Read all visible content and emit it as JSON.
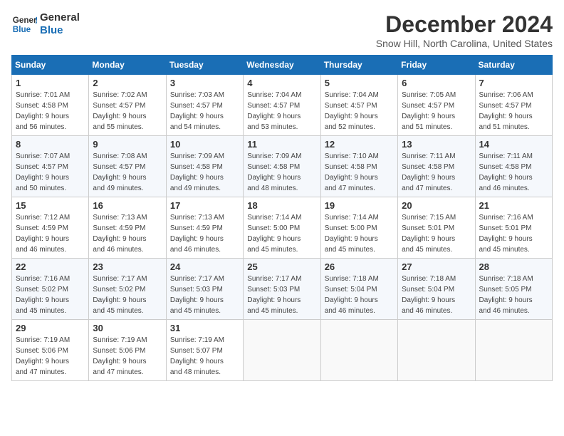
{
  "header": {
    "logo_line1": "General",
    "logo_line2": "Blue",
    "month_title": "December 2024",
    "location": "Snow Hill, North Carolina, United States"
  },
  "days_of_week": [
    "Sunday",
    "Monday",
    "Tuesday",
    "Wednesday",
    "Thursday",
    "Friday",
    "Saturday"
  ],
  "weeks": [
    [
      {
        "day": "1",
        "info": "Sunrise: 7:01 AM\nSunset: 4:58 PM\nDaylight: 9 hours\nand 56 minutes."
      },
      {
        "day": "2",
        "info": "Sunrise: 7:02 AM\nSunset: 4:57 PM\nDaylight: 9 hours\nand 55 minutes."
      },
      {
        "day": "3",
        "info": "Sunrise: 7:03 AM\nSunset: 4:57 PM\nDaylight: 9 hours\nand 54 minutes."
      },
      {
        "day": "4",
        "info": "Sunrise: 7:04 AM\nSunset: 4:57 PM\nDaylight: 9 hours\nand 53 minutes."
      },
      {
        "day": "5",
        "info": "Sunrise: 7:04 AM\nSunset: 4:57 PM\nDaylight: 9 hours\nand 52 minutes."
      },
      {
        "day": "6",
        "info": "Sunrise: 7:05 AM\nSunset: 4:57 PM\nDaylight: 9 hours\nand 51 minutes."
      },
      {
        "day": "7",
        "info": "Sunrise: 7:06 AM\nSunset: 4:57 PM\nDaylight: 9 hours\nand 51 minutes."
      }
    ],
    [
      {
        "day": "8",
        "info": "Sunrise: 7:07 AM\nSunset: 4:57 PM\nDaylight: 9 hours\nand 50 minutes."
      },
      {
        "day": "9",
        "info": "Sunrise: 7:08 AM\nSunset: 4:57 PM\nDaylight: 9 hours\nand 49 minutes."
      },
      {
        "day": "10",
        "info": "Sunrise: 7:09 AM\nSunset: 4:58 PM\nDaylight: 9 hours\nand 49 minutes."
      },
      {
        "day": "11",
        "info": "Sunrise: 7:09 AM\nSunset: 4:58 PM\nDaylight: 9 hours\nand 48 minutes."
      },
      {
        "day": "12",
        "info": "Sunrise: 7:10 AM\nSunset: 4:58 PM\nDaylight: 9 hours\nand 47 minutes."
      },
      {
        "day": "13",
        "info": "Sunrise: 7:11 AM\nSunset: 4:58 PM\nDaylight: 9 hours\nand 47 minutes."
      },
      {
        "day": "14",
        "info": "Sunrise: 7:11 AM\nSunset: 4:58 PM\nDaylight: 9 hours\nand 46 minutes."
      }
    ],
    [
      {
        "day": "15",
        "info": "Sunrise: 7:12 AM\nSunset: 4:59 PM\nDaylight: 9 hours\nand 46 minutes."
      },
      {
        "day": "16",
        "info": "Sunrise: 7:13 AM\nSunset: 4:59 PM\nDaylight: 9 hours\nand 46 minutes."
      },
      {
        "day": "17",
        "info": "Sunrise: 7:13 AM\nSunset: 4:59 PM\nDaylight: 9 hours\nand 46 minutes."
      },
      {
        "day": "18",
        "info": "Sunrise: 7:14 AM\nSunset: 5:00 PM\nDaylight: 9 hours\nand 45 minutes."
      },
      {
        "day": "19",
        "info": "Sunrise: 7:14 AM\nSunset: 5:00 PM\nDaylight: 9 hours\nand 45 minutes."
      },
      {
        "day": "20",
        "info": "Sunrise: 7:15 AM\nSunset: 5:01 PM\nDaylight: 9 hours\nand 45 minutes."
      },
      {
        "day": "21",
        "info": "Sunrise: 7:16 AM\nSunset: 5:01 PM\nDaylight: 9 hours\nand 45 minutes."
      }
    ],
    [
      {
        "day": "22",
        "info": "Sunrise: 7:16 AM\nSunset: 5:02 PM\nDaylight: 9 hours\nand 45 minutes."
      },
      {
        "day": "23",
        "info": "Sunrise: 7:17 AM\nSunset: 5:02 PM\nDaylight: 9 hours\nand 45 minutes."
      },
      {
        "day": "24",
        "info": "Sunrise: 7:17 AM\nSunset: 5:03 PM\nDaylight: 9 hours\nand 45 minutes."
      },
      {
        "day": "25",
        "info": "Sunrise: 7:17 AM\nSunset: 5:03 PM\nDaylight: 9 hours\nand 45 minutes."
      },
      {
        "day": "26",
        "info": "Sunrise: 7:18 AM\nSunset: 5:04 PM\nDaylight: 9 hours\nand 46 minutes."
      },
      {
        "day": "27",
        "info": "Sunrise: 7:18 AM\nSunset: 5:04 PM\nDaylight: 9 hours\nand 46 minutes."
      },
      {
        "day": "28",
        "info": "Sunrise: 7:18 AM\nSunset: 5:05 PM\nDaylight: 9 hours\nand 46 minutes."
      }
    ],
    [
      {
        "day": "29",
        "info": "Sunrise: 7:19 AM\nSunset: 5:06 PM\nDaylight: 9 hours\nand 47 minutes."
      },
      {
        "day": "30",
        "info": "Sunrise: 7:19 AM\nSunset: 5:06 PM\nDaylight: 9 hours\nand 47 minutes."
      },
      {
        "day": "31",
        "info": "Sunrise: 7:19 AM\nSunset: 5:07 PM\nDaylight: 9 hours\nand 48 minutes."
      },
      {
        "day": "",
        "info": ""
      },
      {
        "day": "",
        "info": ""
      },
      {
        "day": "",
        "info": ""
      },
      {
        "day": "",
        "info": ""
      }
    ]
  ]
}
